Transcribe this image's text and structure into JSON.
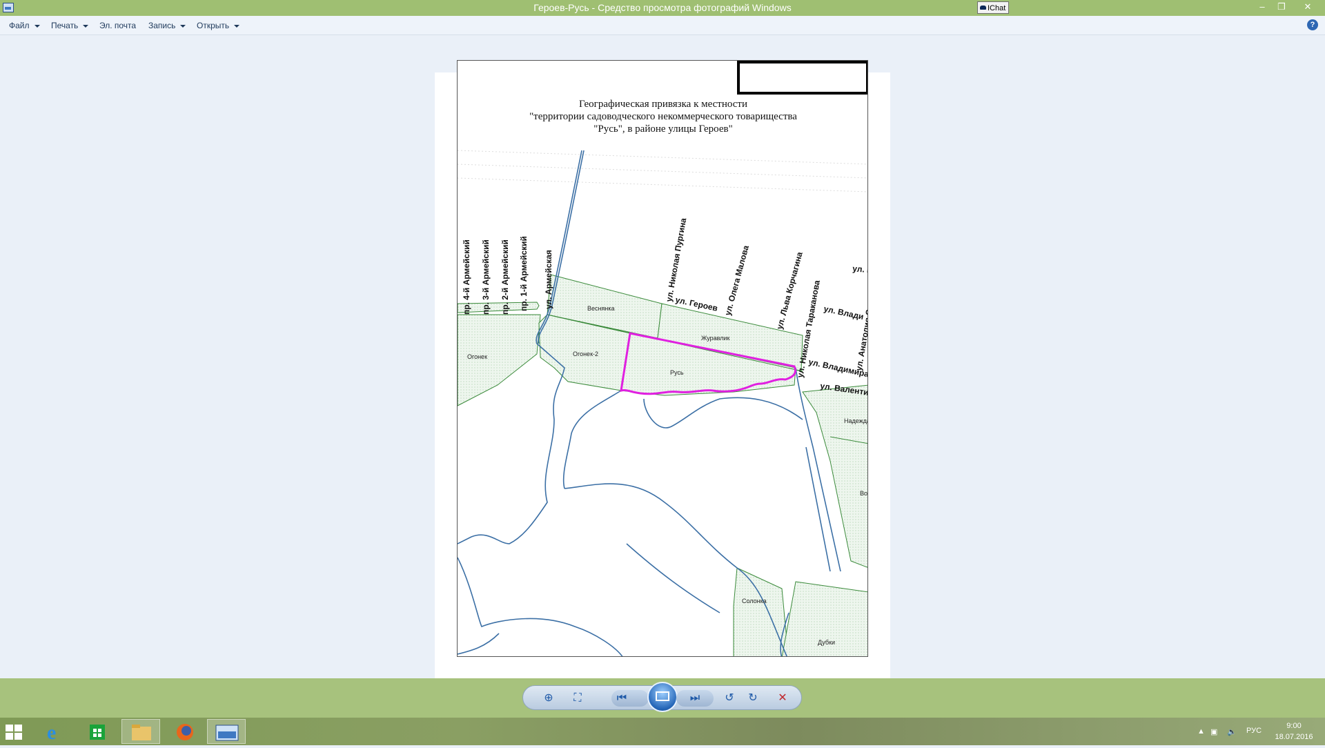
{
  "window": {
    "title": "Героев-Русь - Средство просмотра фотографий Windows",
    "extra_tab": "IChat",
    "minimize_glyph": "–",
    "restore_glyph": "❐",
    "close_glyph": "✕"
  },
  "menu": {
    "items": [
      {
        "label": "Файл"
      },
      {
        "label": "Печать"
      },
      {
        "label": "Эл. почта"
      },
      {
        "label": "Запись"
      },
      {
        "label": "Открыть"
      }
    ],
    "help_glyph": "?"
  },
  "document": {
    "title_lines": [
      "Географическая привязка к местности",
      "\"территории садоводческого некоммерческого товарищества",
      "\"Русь\", в районе улицы Героев\""
    ],
    "streets": [
      "пр. 4-й Армейский",
      "пр. 3-й Армейский",
      "пр. 2-й Армейский",
      "пр. 1-й Армейский",
      "ул. Армейская",
      "ул. Николая Пургина",
      "ул. Олега Малова",
      "ул. Льва Корчагина",
      "ул. Николая Тараканова",
      "ул. Анатолия С",
      "ул. Ц",
      "ул. Влади",
      "ул. Героев",
      "ул. Владимира",
      "ул. Валенти"
    ],
    "areas": [
      "Веснянка",
      "Журавлик",
      "Огонек",
      "Огонек-2",
      "Русь",
      "Надежда",
      "Вол",
      "Солонка",
      "Дубки"
    ],
    "highlight_color": "#e020e0",
    "area_fill_color": "#e6f2e6",
    "area_border_color": "#3a8a3a",
    "water_color": "#3b6fa5"
  },
  "controls": {
    "zoom_glyph": "⊕",
    "actual_size_glyph": "⛶",
    "previous_glyph": "⏮",
    "next_glyph": "⏭",
    "rotate_ccw_glyph": "↺",
    "rotate_cw_glyph": "↻",
    "delete_glyph": "✕"
  },
  "taskbar": {
    "language": "РУС",
    "time": "9:00",
    "date": "18.07.2016"
  }
}
